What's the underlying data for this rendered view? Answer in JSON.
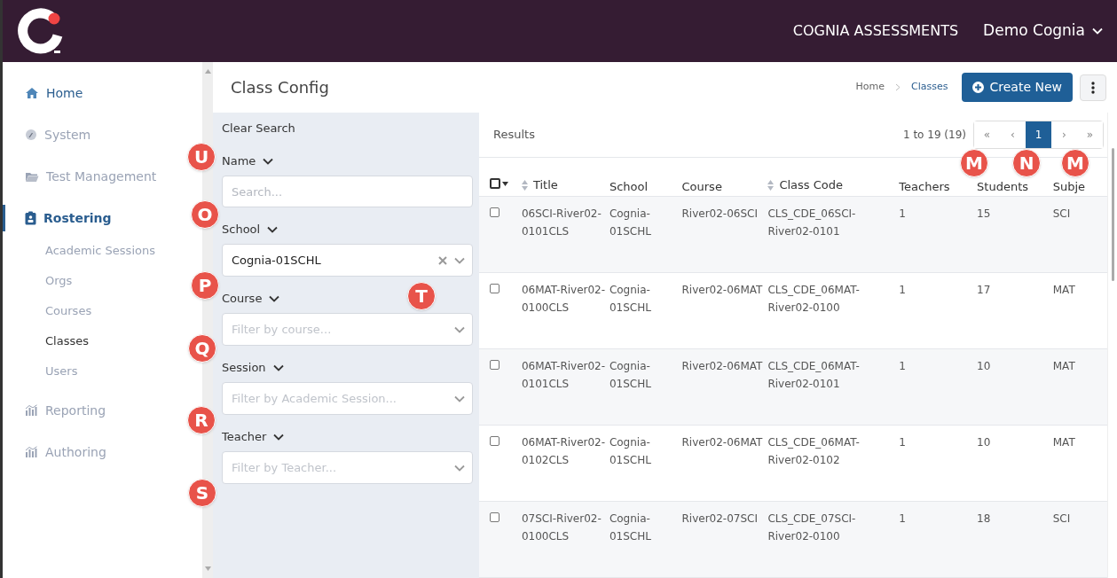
{
  "topbar": {
    "product": "COGNIA ASSESSMENTS",
    "user": "Demo Cognia"
  },
  "sidebar": {
    "items": [
      {
        "label": "Home",
        "selected": false
      },
      {
        "label": "System",
        "selected": false
      },
      {
        "label": "Test Management",
        "selected": false
      },
      {
        "label": "Rostering",
        "selected": true,
        "children": [
          {
            "label": "Academic Sessions",
            "selected": false
          },
          {
            "label": "Orgs",
            "selected": false
          },
          {
            "label": "Courses",
            "selected": false
          },
          {
            "label": "Classes",
            "selected": true
          },
          {
            "label": "Users",
            "selected": false
          }
        ]
      },
      {
        "label": "Reporting",
        "selected": false
      },
      {
        "label": "Authoring",
        "selected": false
      }
    ]
  },
  "page": {
    "title": "Class Config",
    "breadcrumb": [
      "Home",
      "Classes"
    ],
    "create_button": "Create New"
  },
  "filters": {
    "clear": "Clear Search",
    "groups": [
      {
        "label": "Name",
        "kind": "text",
        "placeholder": "Search..."
      },
      {
        "label": "School",
        "kind": "select",
        "value": "Cognia-01SCHL"
      },
      {
        "label": "Course",
        "kind": "select",
        "placeholder": "Filter by course..."
      },
      {
        "label": "Session",
        "kind": "select",
        "placeholder": "Filter by Academic Session..."
      },
      {
        "label": "Teacher",
        "kind": "select",
        "placeholder": "Filter by Teacher..."
      }
    ]
  },
  "results": {
    "title": "Results",
    "range": "1 to 19 (19)",
    "pager": [
      {
        "label": "«",
        "selected": false
      },
      {
        "label": "‹",
        "selected": false
      },
      {
        "label": "1",
        "selected": true
      },
      {
        "label": "›",
        "selected": false
      },
      {
        "label": "»",
        "selected": false
      }
    ]
  },
  "table": {
    "select_all": {
      "checked": false
    },
    "columns": [
      {
        "label": "Title",
        "sortable": true
      },
      {
        "label": "School",
        "sortable": false
      },
      {
        "label": "Course",
        "sortable": false
      },
      {
        "label": "Class Code",
        "sortable": true
      },
      {
        "label": "Teachers",
        "sortable": false
      },
      {
        "label": "Students",
        "sortable": false
      },
      {
        "label": "Subje",
        "sortable": false
      }
    ],
    "rows": [
      {
        "checked": false,
        "cells": [
          "06SCI-River02-0101CLS",
          "Cognia-01SCHL",
          "River02-06SCI",
          "CLS_CDE_06SCI-River02-0101",
          "1",
          "15",
          "SCI"
        ]
      },
      {
        "checked": false,
        "cells": [
          "06MAT-River02-0100CLS",
          "Cognia-01SCHL",
          "River02-06MAT",
          "CLS_CDE_06MAT-River02-0100",
          "1",
          "17",
          "MAT"
        ]
      },
      {
        "checked": false,
        "cells": [
          "06MAT-River02-0101CLS",
          "Cognia-01SCHL",
          "River02-06MAT",
          "CLS_CDE_06MAT-River02-0101",
          "1",
          "10",
          "MAT"
        ]
      },
      {
        "checked": false,
        "cells": [
          "06MAT-River02-0102CLS",
          "Cognia-01SCHL",
          "River02-06MAT",
          "CLS_CDE_06MAT-River02-0102",
          "1",
          "10",
          "MAT"
        ]
      },
      {
        "checked": false,
        "cells": [
          "07SCI-River02-0100CLS",
          "Cognia-01SCHL",
          "River02-07SCI",
          "CLS_CDE_07SCI-River02-0100",
          "1",
          "18",
          "SCI"
        ]
      }
    ]
  },
  "callouts": [
    "U",
    "O",
    "P",
    "T",
    "Q",
    "R",
    "S",
    "M",
    "N",
    "M"
  ]
}
